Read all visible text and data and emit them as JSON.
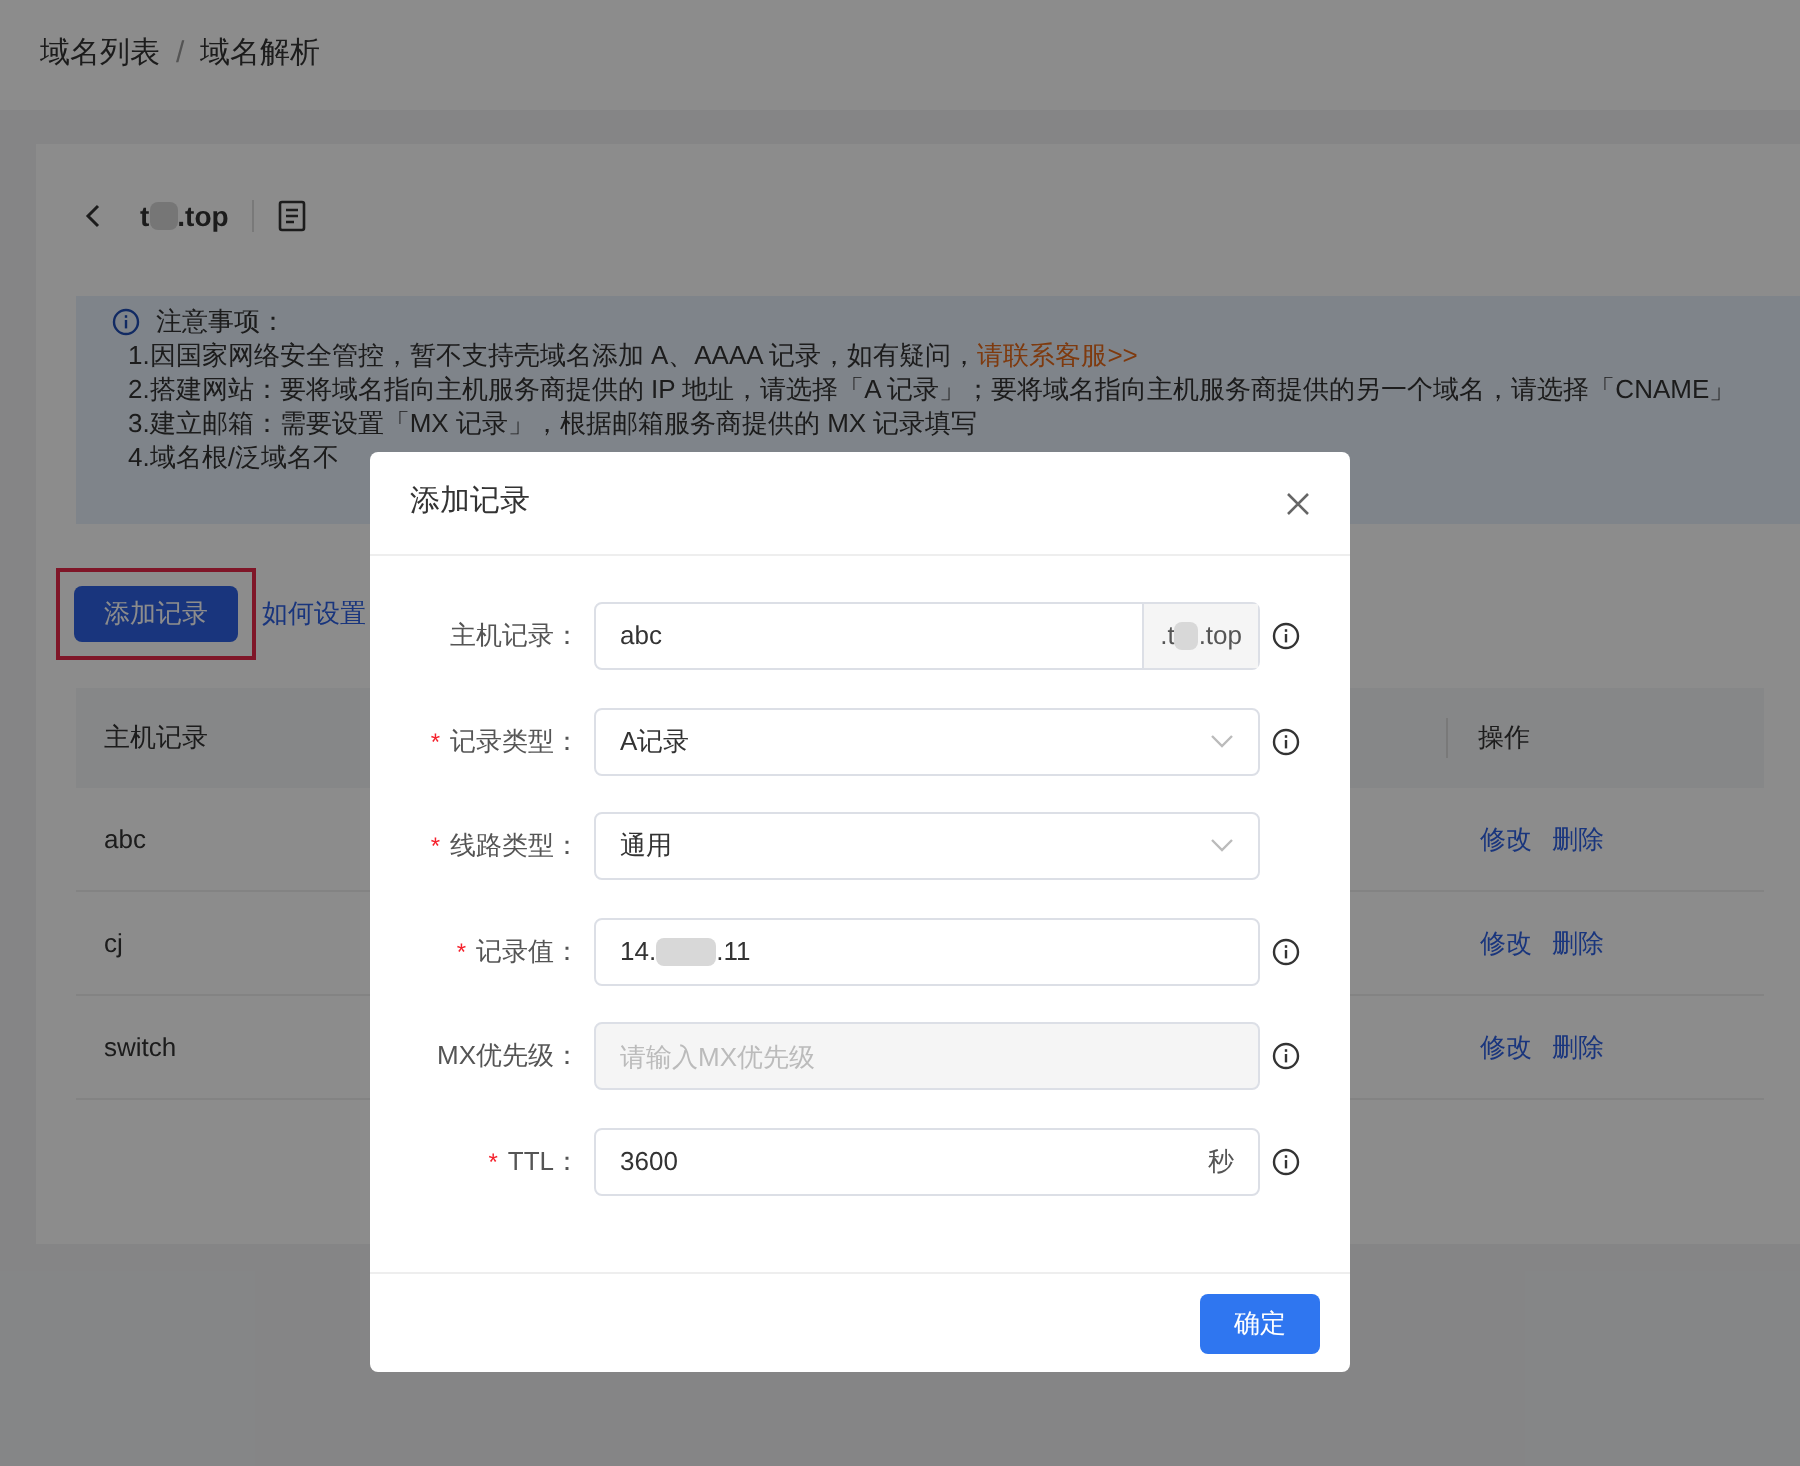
{
  "breadcrumb": [
    {
      "label": "域名列表"
    },
    {
      "label": "域名解析"
    }
  ],
  "breadcrumb_separator": "/",
  "domain": {
    "start": "t",
    "end": ".top"
  },
  "notice": {
    "title": "注意事项：",
    "lines": [
      {
        "text": "1.因国家网络安全管控，暂不支持壳域名添加 A、AAAA 记录，如有疑问，",
        "link": "请联系客服>>"
      },
      {
        "text": "2.搭建网站：要将域名指向主机服务商提供的 IP 地址，请选择「A 记录」；要将域名指向主机服务商提供的另一个域名，请选择「CNAME」"
      },
      {
        "text": "3.建立邮箱：需要设置「MX 记录」，根据邮箱服务商提供的 MX 记录填写"
      },
      {
        "text": "4.域名根/泛域名不"
      }
    ]
  },
  "add_button": "添加记录",
  "help_link": "如何设置",
  "table": {
    "columns": [
      "主机记录",
      "操作"
    ],
    "rows": [
      {
        "host": "abc",
        "actions": [
          "修改",
          "删除"
        ]
      },
      {
        "host": "cj",
        "actions": [
          "修改",
          "删除"
        ]
      },
      {
        "host": "switch",
        "actions": [
          "修改",
          "删除"
        ]
      }
    ]
  },
  "dialog": {
    "title": "添加记录",
    "fields": [
      {
        "kind": "addon",
        "label": "主机记录：",
        "required": false,
        "info": true,
        "value": "abc",
        "addon_start": ".t",
        "addon_end": ".top"
      },
      {
        "kind": "select",
        "label": "记录类型：",
        "required": true,
        "info": true,
        "value": "A记录"
      },
      {
        "kind": "select",
        "label": "线路类型：",
        "required": true,
        "info": false,
        "value": "通用"
      },
      {
        "kind": "masked",
        "label": "记录值：",
        "required": true,
        "info": true,
        "value_start": "14.",
        "value_end": ".11"
      },
      {
        "kind": "disabled",
        "label": "MX优先级：",
        "required": false,
        "info": true,
        "placeholder": "请输入MX优先级"
      },
      {
        "kind": "unit",
        "label": "TTL：",
        "required": true,
        "info": true,
        "value": "3600",
        "unit": "秒"
      }
    ],
    "required_mark": "*",
    "confirm": "确定"
  }
}
